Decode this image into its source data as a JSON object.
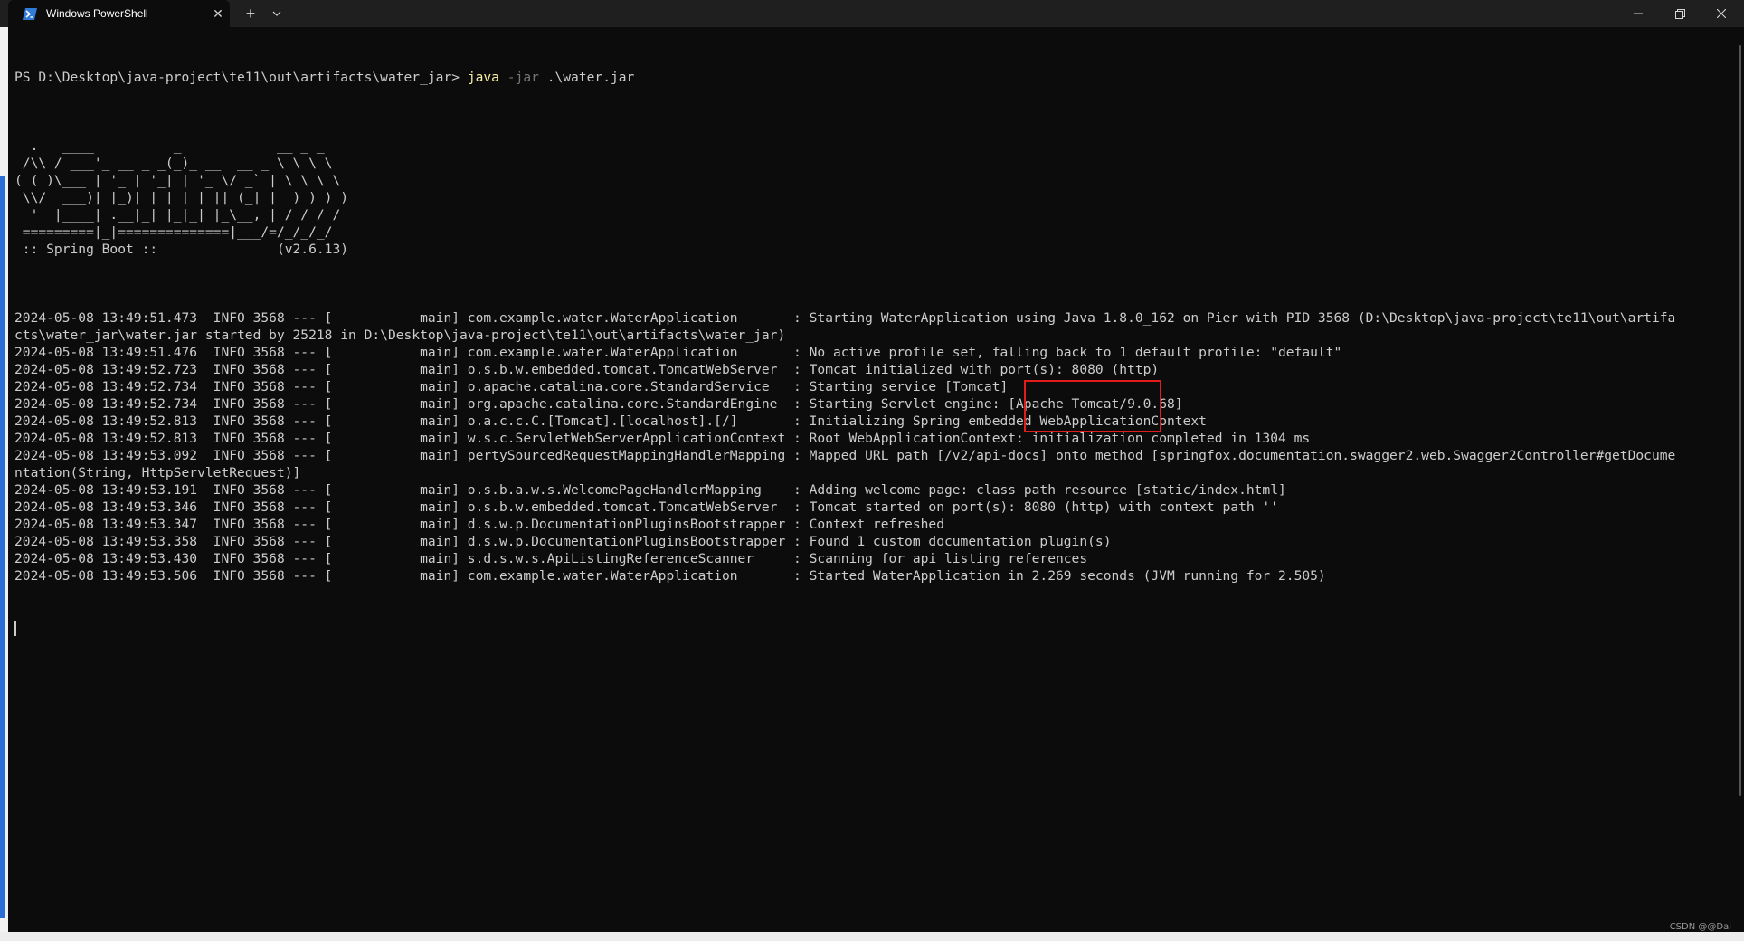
{
  "window": {
    "tab_title": "Windows PowerShell",
    "tab_close_glyph": "✕",
    "new_tab_glyph": "+",
    "dropdown_glyph": "⌄",
    "minimize_glyph": "—",
    "maximize_glyph": "❐",
    "close_glyph": "✕",
    "tab_icon": "powershell-icon",
    "highlight_color": "#e31b1b"
  },
  "prompt": {
    "path": "PS D:\\Desktop\\java-project\\te11\\out\\artifacts\\water_jar> ",
    "command": "java",
    "param": " -jar",
    "argument": " .\\water.jar"
  },
  "banner": [
    "",
    "  .   ____          _            __ _ _",
    " /\\\\ / ___'_ __ _ _(_)_ __  __ _ \\ \\ \\ \\",
    "( ( )\\___ | '_ | '_| | '_ \\/ _` | \\ \\ \\ \\",
    " \\\\/  ___)| |_)| | | | | || (_| |  ) ) ) )",
    "  '  |____| .__|_| |_|_| |_\\__, | / / / /",
    " =========|_|==============|___/=/_/_/_/",
    " :: Spring Boot ::               (v2.6.13)",
    ""
  ],
  "log_lines": [
    "2024-05-08 13:49:51.473  INFO 3568 --- [           main] com.example.water.WaterApplication       : Starting WaterApplication using Java 1.8.0_162 on Pier with PID 3568 (D:\\Desktop\\java-project\\te11\\out\\artifa",
    "cts\\water_jar\\water.jar started by 25218 in D:\\Desktop\\java-project\\te11\\out\\artifacts\\water_jar)",
    "2024-05-08 13:49:51.476  INFO 3568 --- [           main] com.example.water.WaterApplication       : No active profile set, falling back to 1 default profile: \"default\"",
    "2024-05-08 13:49:52.723  INFO 3568 --- [           main] o.s.b.w.embedded.tomcat.TomcatWebServer  : Tomcat initialized with port(s): 8080 (http)",
    "2024-05-08 13:49:52.734  INFO 3568 --- [           main] o.apache.catalina.core.StandardService   : Starting service [Tomcat]",
    "2024-05-08 13:49:52.734  INFO 3568 --- [           main] org.apache.catalina.core.StandardEngine  : Starting Servlet engine: [Apache Tomcat/9.0.68]",
    "2024-05-08 13:49:52.813  INFO 3568 --- [           main] o.a.c.c.C.[Tomcat].[localhost].[/]       : Initializing Spring embedded WebApplicationContext",
    "2024-05-08 13:49:52.813  INFO 3568 --- [           main] w.s.c.ServletWebServerApplicationContext : Root WebApplicationContext: initialization completed in 1304 ms",
    "2024-05-08 13:49:53.092  INFO 3568 --- [           main] pertySourcedRequestMappingHandlerMapping : Mapped URL path [/v2/api-docs] onto method [springfox.documentation.swagger2.web.Swagger2Controller#getDocume",
    "ntation(String, HttpServletRequest)]",
    "2024-05-08 13:49:53.191  INFO 3568 --- [           main] o.s.b.a.w.s.WelcomePageHandlerMapping    : Adding welcome page: class path resource [static/index.html]",
    "2024-05-08 13:49:53.346  INFO 3568 --- [           main] o.s.b.w.embedded.tomcat.TomcatWebServer  : Tomcat started on port(s): 8080 (http) with context path ''",
    "2024-05-08 13:49:53.347  INFO 3568 --- [           main] d.s.w.p.DocumentationPluginsBootstrapper : Context refreshed",
    "2024-05-08 13:49:53.358  INFO 3568 --- [           main] d.s.w.p.DocumentationPluginsBootstrapper : Found 1 custom documentation plugin(s)",
    "2024-05-08 13:49:53.430  INFO 3568 --- [           main] s.d.s.w.s.ApiListingReferenceScanner     : Scanning for api listing references",
    "2024-05-08 13:49:53.506  INFO 3568 --- [           main] com.example.water.WaterApplication       : Started WaterApplication in 2.269 seconds (JVM running for 2.505)"
  ],
  "watermark": "CSDN @@Dai"
}
